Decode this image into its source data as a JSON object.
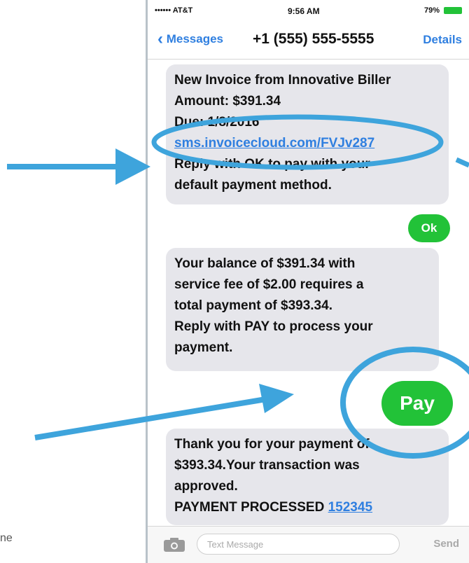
{
  "status": {
    "carrier": "•••••• AT&T",
    "time": "9:56 AM",
    "battery": "79%"
  },
  "nav": {
    "back_label": "Messages",
    "contact": "+1 (555) 555-5555",
    "details_label": "Details"
  },
  "messages": {
    "m1": {
      "line1": "New Invoice from Innovative Biller",
      "line2": "Amount: $391.34",
      "line3": "Due: 1/8/2016",
      "link": "sms.invoicecloud.com/FVJv287",
      "line4": "Reply with OK to pay with your",
      "line5": "default payment method."
    },
    "m2": {
      "text": "Ok"
    },
    "m3": {
      "line1": "Your balance of $391.34 with",
      "line2": "service fee of $2.00 requires a",
      "line3": "total payment of $393.34.",
      "line4": "Reply with PAY to process your",
      "line5": "payment."
    },
    "m4": {
      "text": "Pay"
    },
    "m5": {
      "line1": "Thank you for your payment of",
      "line2": "$393.34.Your transaction was",
      "line3": "approved.",
      "line4_prefix": "PAYMENT PROCESSED ",
      "line4_link": "152345"
    }
  },
  "input": {
    "placeholder": "Text Message",
    "send_label": "Send"
  },
  "outer_text": "ne",
  "colors": {
    "accent_blue": "#2f7fe0",
    "annotation_blue": "#3ea4dc",
    "green_bubble": "#22c238",
    "grey_bubble": "#e6e6eb"
  }
}
